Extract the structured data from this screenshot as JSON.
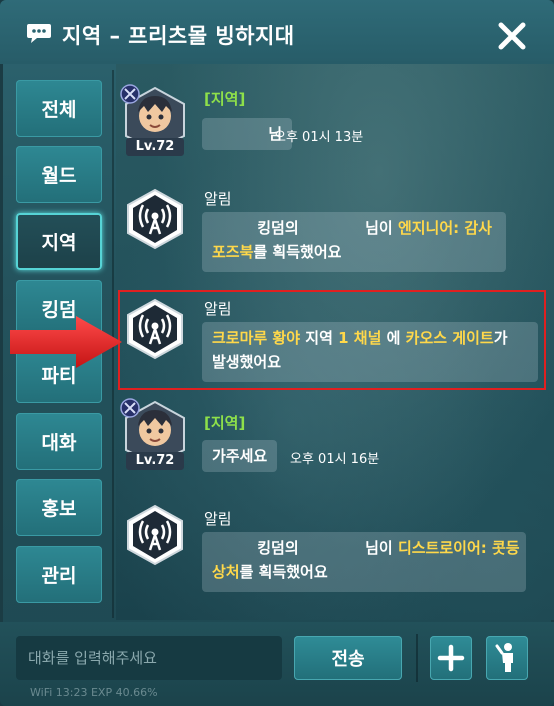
{
  "header": {
    "title": "지역 – 프리츠몰 빙하지대",
    "chat_icon": "chat-bubble-icon",
    "close_icon": "close-icon"
  },
  "sidebar": {
    "tabs": [
      {
        "label": "전체",
        "active": false
      },
      {
        "label": "월드",
        "active": false
      },
      {
        "label": "지역",
        "active": true
      },
      {
        "label": "킹덤",
        "active": false
      },
      {
        "label": "파티",
        "active": false
      },
      {
        "label": "대화",
        "active": false
      },
      {
        "label": "홍보",
        "active": false
      },
      {
        "label": "관리",
        "active": false
      }
    ]
  },
  "messages": [
    {
      "type": "player",
      "channel": "[지역]",
      "level": "Lv.72",
      "text": "님",
      "time": "오후 01시 13분"
    },
    {
      "type": "notice",
      "sender": "알림",
      "line1_a": "킹덤의",
      "line1_b": "님이",
      "line1_item": "엔지니어: 감사",
      "line2_item": "포즈북",
      "line2_rest": "를 획득했어요"
    },
    {
      "type": "notice",
      "sender": "알림",
      "place": "크로마루 황야",
      "word_region": "지역",
      "channel": "1 채널",
      "word_at": "에",
      "gate": "카오스 게이트",
      "suffix": "가",
      "line2": "발생했어요"
    },
    {
      "type": "player",
      "channel": "[지역]",
      "level": "Lv.72",
      "text": "가주세요",
      "time": "오후 01시 16분"
    },
    {
      "type": "notice",
      "sender": "알림",
      "line1_a": "킹덤의",
      "line1_b": "님이",
      "line1_item": "디스트로이어: 콧등",
      "line2_item": "상처",
      "line2_rest": "를 획득했어요"
    }
  ],
  "footer": {
    "input_placeholder": "대화를 입력해주세요",
    "input_value": "",
    "send_label": "전송",
    "plus_icon": "plus-icon",
    "emote_icon": "emote-figure-icon",
    "status_text": "WiFi  13:23  EXP 40.66%"
  },
  "colors": {
    "region_channel": "#8ee04a",
    "highlight": "#ffd84a",
    "annotation": "#e02020",
    "active_tab_glow": "#56d4d6"
  }
}
